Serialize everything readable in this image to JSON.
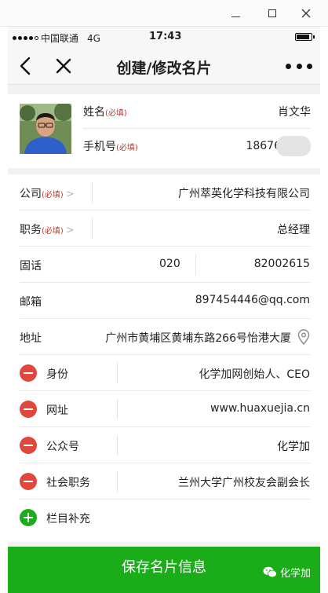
{
  "status_bar": {
    "carrier": "中国联通",
    "network": "4G",
    "time": "17:43"
  },
  "nav": {
    "title": "创建/修改名片"
  },
  "profile": {
    "name_label": "姓名",
    "name_required": "(必填)",
    "name_value": "肖文华",
    "phone_label": "手机号",
    "phone_required": "(必填)",
    "phone_value": "18676"
  },
  "fields": {
    "company_label": "公司",
    "company_required": "(必填)",
    "company_value": "广州萃英化学科技有限公司",
    "position_label": "职务",
    "position_required": "(必填)",
    "position_value": "总经理",
    "landline_label": "固话",
    "landline_area": "020",
    "landline_number": "82002615",
    "email_label": "邮箱",
    "email_value": "897454446@qq.com",
    "address_label": "地址",
    "address_value": "广州市黄埔区黄埔东路266号怡港大厦"
  },
  "extra_fields": [
    {
      "label": "身份",
      "value": "化学加网创始人、CEO"
    },
    {
      "label": "网址",
      "value": "www.huaxuejia.cn"
    },
    {
      "label": "公众号",
      "value": "化学加"
    },
    {
      "label": "社会职务",
      "value": "兰州大学广州校友会副会长"
    }
  ],
  "add_field_label": "栏目补充",
  "save_button": "保存名片信息",
  "watermark": "化学加",
  "colors": {
    "accent_green": "#1aad19",
    "remove_red": "#e0483e",
    "required_red": "#c0392b"
  }
}
